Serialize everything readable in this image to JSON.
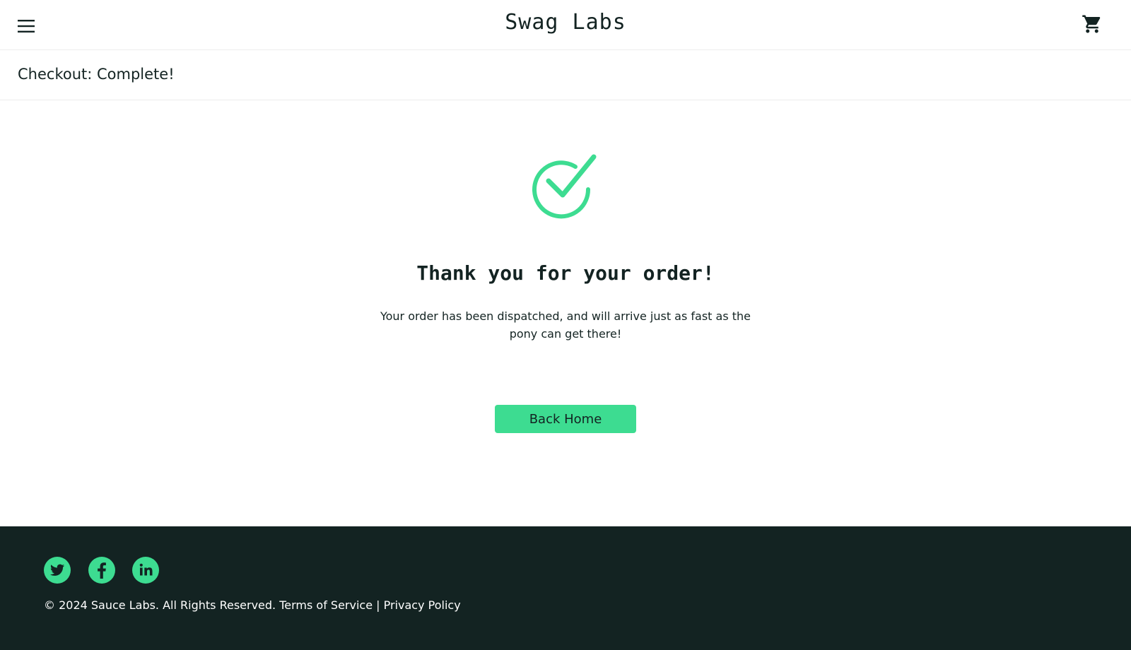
{
  "header": {
    "logo": "Swag Labs",
    "menu_icon": "hamburger-menu-icon",
    "cart_icon": "shopping-cart-icon"
  },
  "subheader": {
    "title": "Checkout: Complete!"
  },
  "complete": {
    "icon": "checkmark-icon",
    "header": "Thank you for your order!",
    "text": "Your order has been dispatched, and will arrive just as fast as the pony can get there!",
    "button_label": "Back Home"
  },
  "footer": {
    "social": [
      "twitter-icon",
      "facebook-icon",
      "linkedin-icon"
    ],
    "copy": "© 2024 Sauce Labs. All Rights Reserved. Terms of Service | Privacy Policy"
  },
  "colors": {
    "accent": "#3ddc91",
    "text_dark": "#132322",
    "footer_bg": "#132322"
  }
}
